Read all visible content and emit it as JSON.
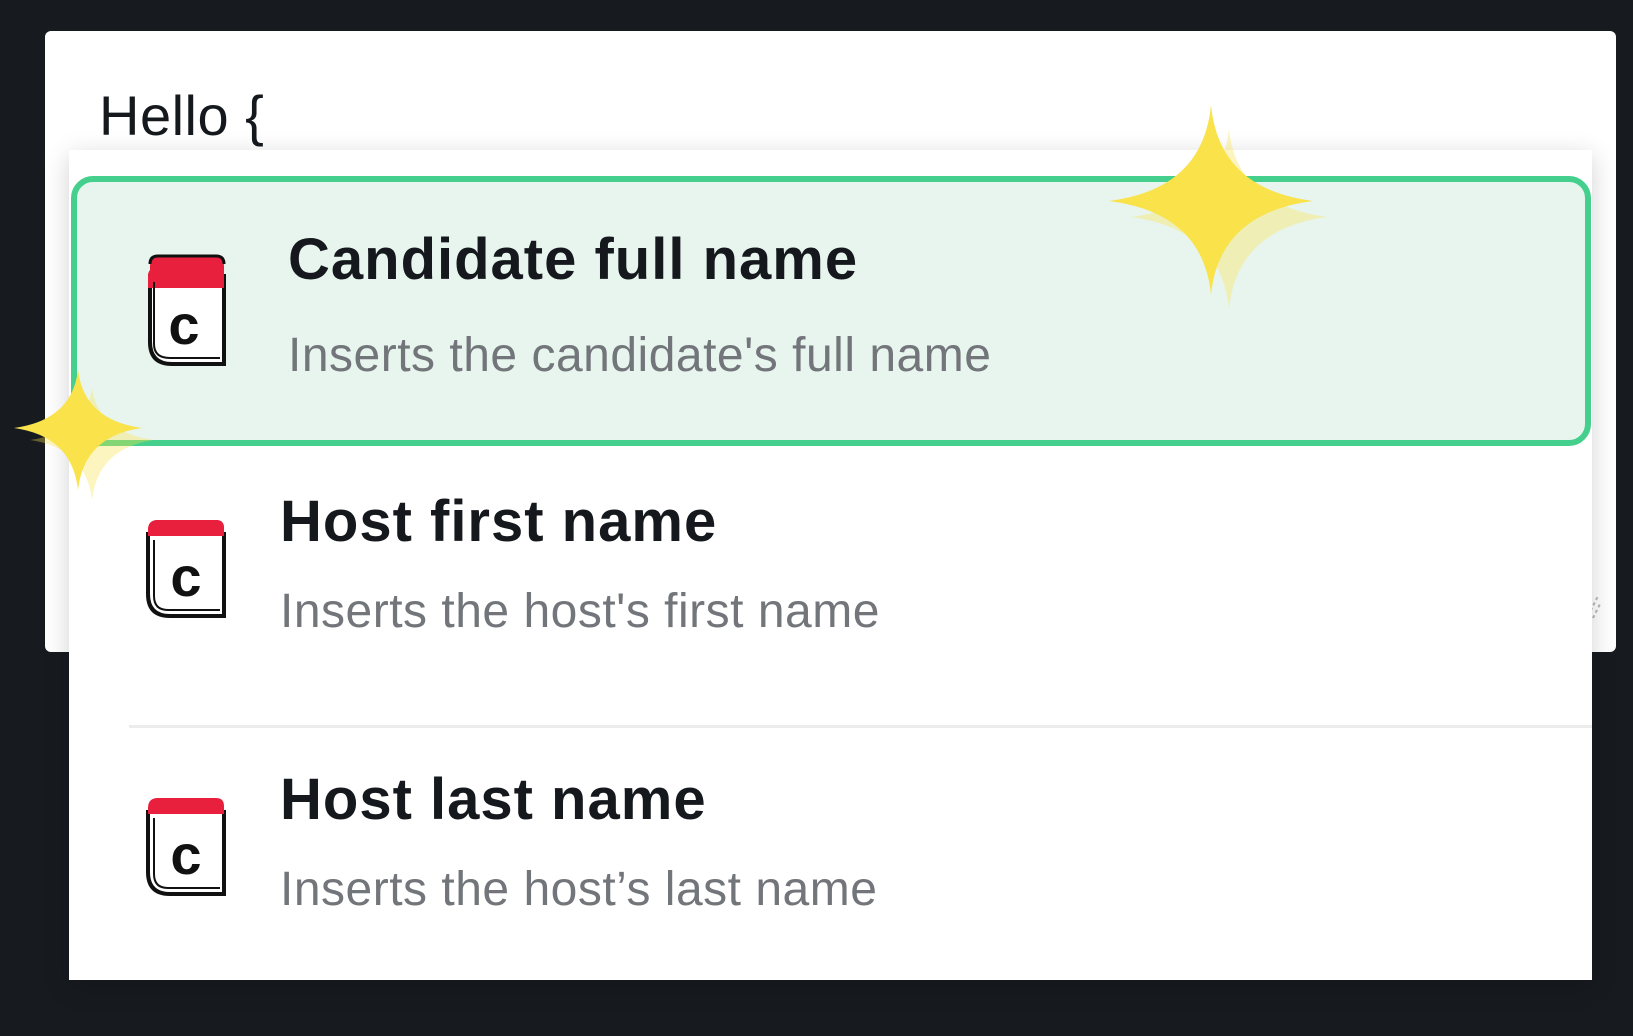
{
  "editor": {
    "text": "Hello {"
  },
  "suggestions": [
    {
      "title": "Candidate full name",
      "description": "Inserts the candidate's full name",
      "icon": "candidate-variable-icon",
      "selected": true
    },
    {
      "title": "Host first name",
      "description": "Inserts the host's first name",
      "icon": "host-variable-icon",
      "selected": false
    },
    {
      "title": "Host last name",
      "description": "Inserts the host’s last name",
      "icon": "host-variable-icon",
      "selected": false
    }
  ],
  "colors": {
    "background": "#171b20",
    "selected_border": "#45cf8c",
    "selected_fill": "#e8f5ee",
    "icon_red": "#e8203e",
    "sparkle": "#f9e24a"
  }
}
